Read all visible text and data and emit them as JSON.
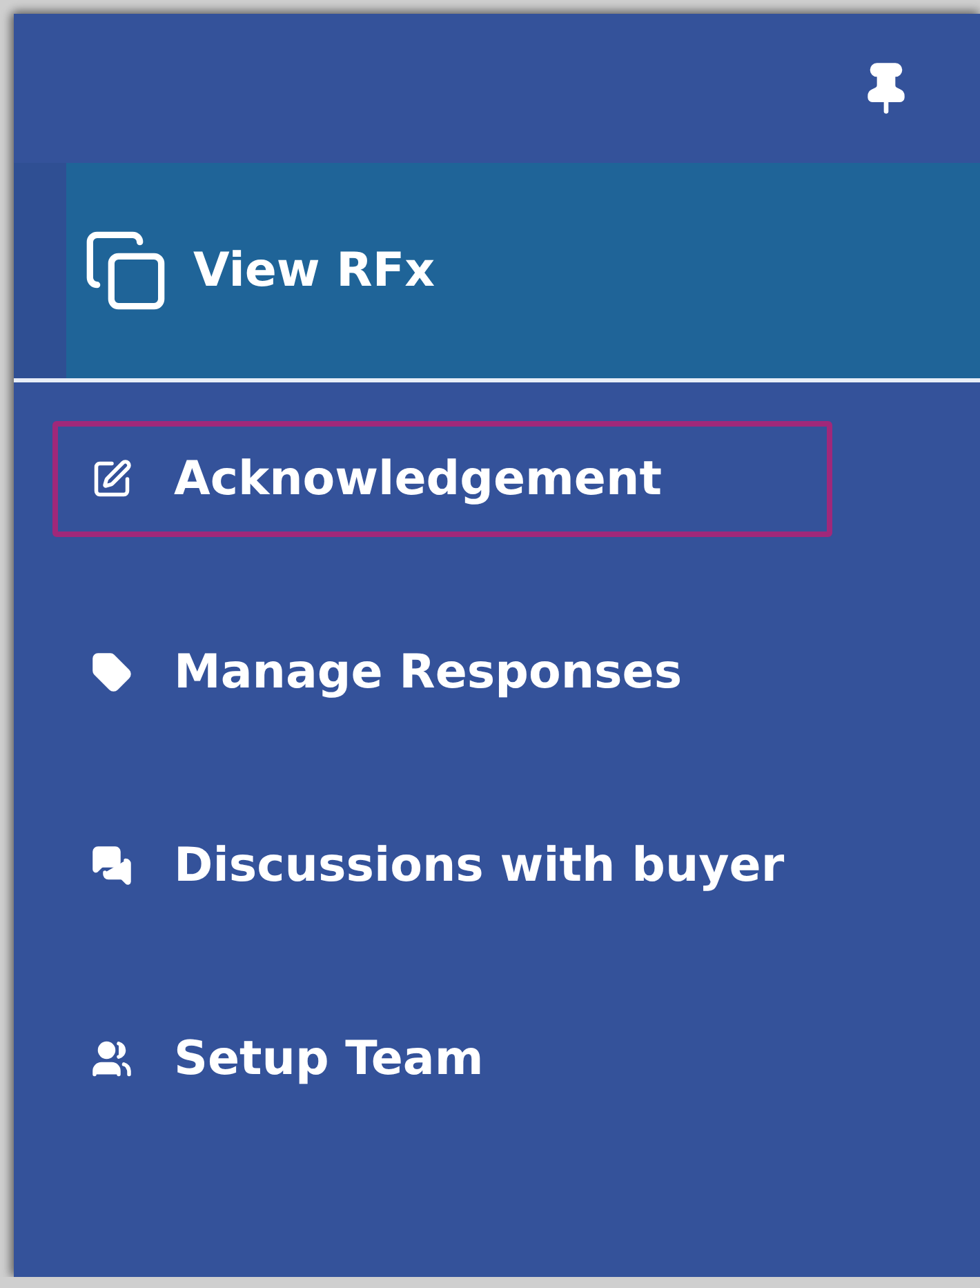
{
  "sidebar": {
    "pinned": true,
    "items": [
      {
        "label": "View RFx",
        "selected": true,
        "highlighted": false
      },
      {
        "label": "Acknowledgement",
        "selected": false,
        "highlighted": true
      },
      {
        "label": "Manage Responses",
        "selected": false,
        "highlighted": false
      },
      {
        "label": "Discussions with buyer",
        "selected": false,
        "highlighted": false
      },
      {
        "label": "Setup Team",
        "selected": false,
        "highlighted": false
      }
    ]
  }
}
